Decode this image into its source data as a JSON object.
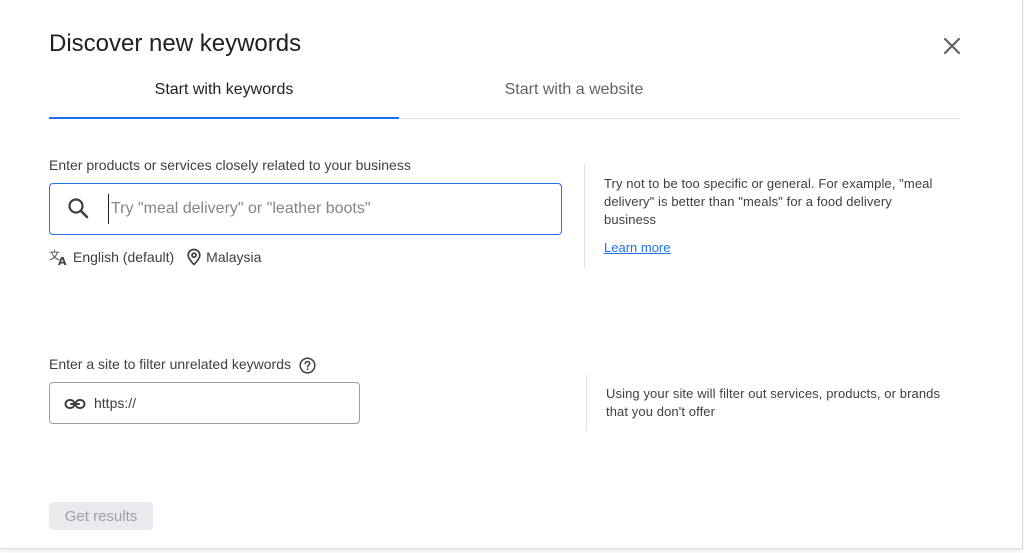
{
  "dialog": {
    "title": "Discover new keywords"
  },
  "tabs": [
    {
      "label": "Start with keywords",
      "active": true
    },
    {
      "label": "Start with a website",
      "active": false
    }
  ],
  "keywords_section": {
    "label": "Enter products or services closely related to your business",
    "input_value": "",
    "input_placeholder": "Try \"meal delivery\" or \"leather boots\"",
    "language": "English (default)",
    "location": "Malaysia",
    "help_text": "Try not to be too specific or general. For example, \"meal delivery\" is better than \"meals\" for a food delivery business",
    "learn_more": "Learn more"
  },
  "site_section": {
    "label": "Enter a site to filter unrelated keywords",
    "input_value": "",
    "input_placeholder": "https://",
    "help_text": "Using your site will filter out services, products, or brands that you don't offer"
  },
  "actions": {
    "get_results": "Get results",
    "get_results_disabled": true
  },
  "colors": {
    "accent": "#1a73e8",
    "text": "#202124",
    "muted": "#5f6368",
    "disabled_bg": "#e8eaed",
    "disabled_text": "#9aa0a6"
  },
  "icons": {
    "close": "close-icon",
    "search": "search-icon",
    "language": "translate-icon",
    "location": "location-pin-icon",
    "help": "help-circle-icon",
    "link": "link-icon"
  }
}
